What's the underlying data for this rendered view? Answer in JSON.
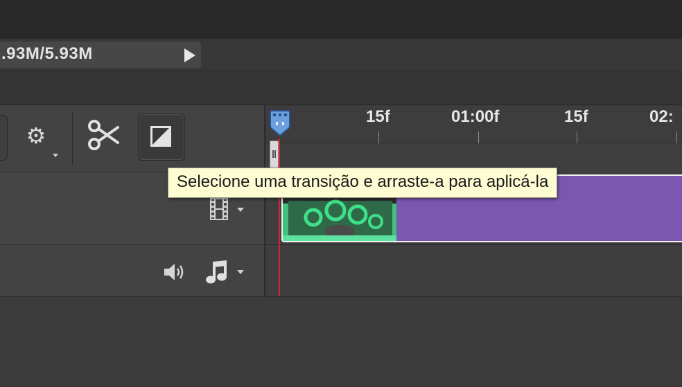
{
  "status_bar": {
    "doc_size": ".93M/5.93M",
    "expand_icon": "triangle-right-icon"
  },
  "toolbar": {
    "settings_icon": "gear-icon",
    "split_icon": "scissors-icon",
    "transition_icon": "transition-icon"
  },
  "ruler": {
    "labels": [
      "15f",
      "01:00f",
      "15f",
      "02:"
    ]
  },
  "tracks": {
    "video_icon": "film-strip-icon",
    "audio_mute_icon": "speaker-icon",
    "audio_icon": "music-note-icon"
  },
  "clip": {
    "color": "#7b57b0",
    "thumb_color": "#2fbf6a"
  },
  "playhead": {
    "color": "#d3262a",
    "handle_color": "#6b9fe0"
  },
  "tooltip": {
    "text": "Selecione uma transição e arraste-a para aplicá-la"
  }
}
